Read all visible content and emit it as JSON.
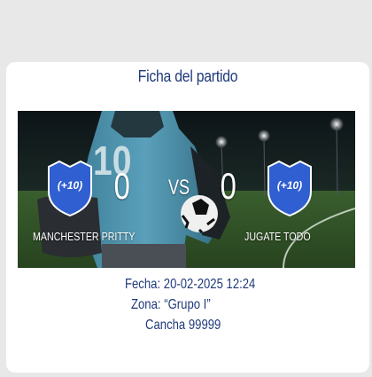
{
  "card": {
    "title": "Ficha del partido"
  },
  "match": {
    "home_team": "MANCHESTER PRITTY",
    "away_team": "JUGATE TODO",
    "home_score": "0",
    "away_score": "0",
    "vs_label": "VS",
    "home_badge_text": "(+10)",
    "away_badge_text": "(+10)",
    "jersey_number": "10"
  },
  "details": {
    "fecha_label": "Fecha:",
    "fecha_value": "20-02-2025 12:24",
    "zona_label": "Zona:",
    "zona_value": "“Grupo I”",
    "cancha": "Cancha 99999"
  },
  "colors": {
    "title_text": "#1f3a7a",
    "shield_blue": "#2f5fd0",
    "card_background": "#ffffff",
    "page_background": "#e8e8e8"
  }
}
